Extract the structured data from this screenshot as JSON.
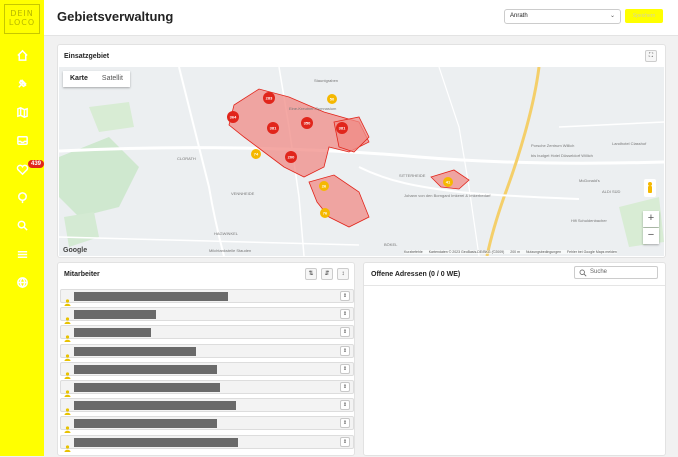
{
  "sidebar": {
    "logo_lines": [
      "DEIN",
      "LOCO"
    ],
    "badge": "439",
    "items": [
      {
        "icon": "home-icon"
      },
      {
        "icon": "pin-icon"
      },
      {
        "icon": "map-icon"
      },
      {
        "icon": "inbox-icon"
      },
      {
        "icon": "heart-icon"
      },
      {
        "icon": "location-icon"
      },
      {
        "icon": "search-icon"
      },
      {
        "icon": "list-icon"
      },
      {
        "icon": "globe-icon"
      }
    ]
  },
  "header": {
    "title": "Gebietsverwaltung",
    "dropdown_value": "Anrath",
    "action_button": "Speichern"
  },
  "map_card": {
    "title": "Einsatzgebiet",
    "tabs": [
      "Karte",
      "Satellit"
    ],
    "clusters": [
      "283",
      "364",
      "50",
      "381",
      "350",
      "381",
      "74",
      "200",
      "26",
      "76",
      "41"
    ],
    "place_labels": [
      "Stauntgraben",
      "Eine-Kreutner-Gymnasium",
      "CLORATH",
      "VENNHEIDE",
      "HAGWINKEL",
      "Milchtankstelle Stauden",
      "SITTERHEIDE",
      "Johann von den Borngard\nImkerei & Imkerbedarf",
      "BÖKEL",
      "Porsche Zentrum Willich",
      "bis budget Hotel\nDüsseldorf Willich",
      "Landhotel Classhof",
      "McDonald's",
      "ALDI SÜD",
      "Hifi Schuldenbacher"
    ],
    "attribution": [
      "Kurzbefehle",
      "Kartendaten © 2023 GeoBasis-DE/BKG (©2009)",
      "200 m",
      "Nutzungsbedingungen",
      "Fehler bei Google Maps melden"
    ],
    "google_logo": "Google",
    "zoom_in": "+",
    "zoom_out": "−"
  },
  "employees_card": {
    "title": "Mitarbeiter",
    "rows": [
      {
        "name_bar_fraction": 0.58
      },
      {
        "name_bar_fraction": 0.31
      },
      {
        "name_bar_fraction": 0.29
      },
      {
        "name_bar_fraction": 0.46
      },
      {
        "name_bar_fraction": 0.54
      },
      {
        "name_bar_fraction": 0.55
      },
      {
        "name_bar_fraction": 0.61
      },
      {
        "name_bar_fraction": 0.54
      },
      {
        "name_bar_fraction": 0.62
      }
    ]
  },
  "addresses_card": {
    "title": "Offene Adressen (0 / 0 WE)",
    "search_placeholder": "Suche"
  },
  "colors": {
    "sidebar": "#ffff00",
    "cluster": "#e1251b",
    "cluster_alt": "#f5b800",
    "area_fill": "#f08b85"
  }
}
